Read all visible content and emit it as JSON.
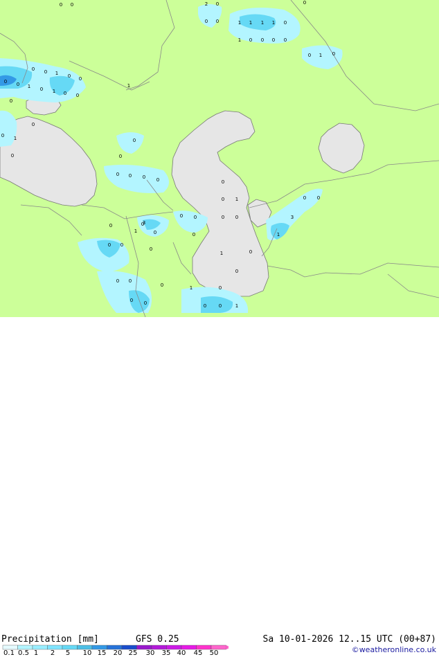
{
  "map": {
    "land_color": "#ccff99",
    "water_color": "#e6e6e6",
    "precip_light_color": "#b3f5ff",
    "precip_mid_color": "#66d9f5",
    "precip_heavy_color": "#3399e6",
    "value_labels": [
      "0",
      "0",
      "2",
      "0",
      "0",
      "0",
      "1",
      "1",
      "1",
      "1",
      "0",
      "0",
      "1",
      "0",
      "0",
      "0",
      "0",
      "0",
      "1",
      "0",
      "0",
      "0",
      "1",
      "0",
      "0",
      "0",
      "0",
      "1",
      "0",
      "1",
      "0",
      "0",
      "1",
      "0",
      "0",
      "0",
      "1",
      "0",
      "0",
      "0",
      "0",
      "0",
      "0",
      "0",
      "0",
      "0",
      "1",
      "0",
      "0",
      "0",
      "0",
      "0",
      "0",
      "0",
      "0",
      "0",
      "1",
      "0",
      "0",
      "0",
      "1",
      "0",
      "1",
      "0",
      "0",
      "0",
      "0",
      "0",
      "0",
      "0",
      "1",
      "0",
      "0",
      "0",
      "1",
      "3",
      "3"
    ]
  },
  "footer": {
    "title": "Precipitation [mm]",
    "model": "GFS 0.25",
    "datetime": "Sa 10-01-2026 12..15 UTC (00+87)",
    "credit": "©weatheronline.co.uk",
    "scale_labels": [
      "0.1",
      "0.5",
      "1",
      "2",
      "5",
      "10",
      "15",
      "20",
      "25",
      "30",
      "35",
      "40",
      "45",
      "50"
    ],
    "scale_colors": [
      "#e6fbff",
      "#b3f5ff",
      "#99eeff",
      "#80e5ff",
      "#66d9f5",
      "#4dbfe6",
      "#3399e6",
      "#2673d9",
      "#1a4dcc",
      "#9919cc",
      "#b31ad9",
      "#cc1ae6",
      "#e61ae6",
      "#ff33cc",
      "#ff66cc"
    ]
  }
}
